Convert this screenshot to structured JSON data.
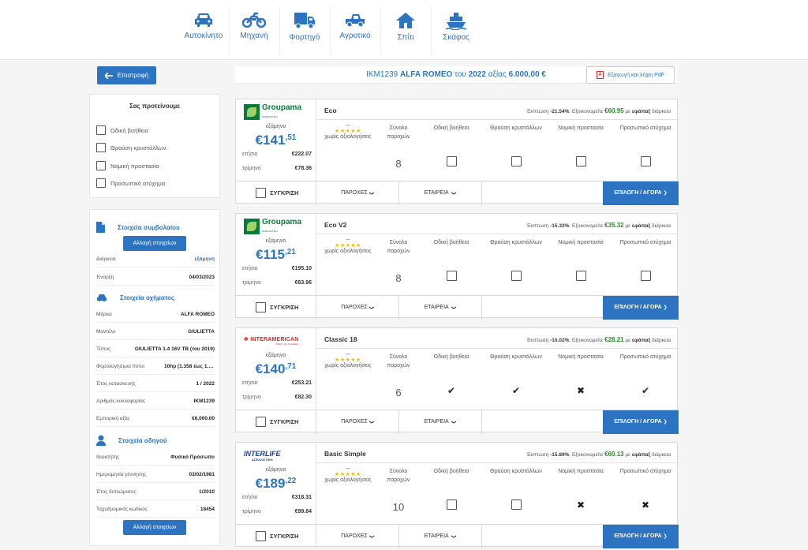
{
  "nav": {
    "items": [
      {
        "label": "Αυτοκίνητο",
        "icon": "car-icon"
      },
      {
        "label": "Μηχανή",
        "icon": "motorcycle-icon"
      },
      {
        "label": "Φορτηγό",
        "icon": "truck-icon"
      },
      {
        "label": "Αγροτικό",
        "icon": "pickup-icon"
      },
      {
        "label": "Σπίτι",
        "icon": "house-icon"
      },
      {
        "label": "Σκάφος",
        "icon": "boat-icon"
      }
    ]
  },
  "header": {
    "back_label": "Επιστροφή",
    "vehicle_prefix": "IKM1239",
    "vehicle_brand": "ALFA ROMEO",
    "vehicle_mid1": "του",
    "vehicle_year": "2022",
    "vehicle_mid2": "αξίας",
    "vehicle_value": "6.000,00 €",
    "pdf_label": "Εξαγωγή και λήψη PdF"
  },
  "suggest": {
    "title": "Σας προτείνουμε",
    "items": [
      "Οδική βοήθεια",
      "Θραύση κρυστάλλων",
      "Νομική προστασία",
      "Προσωπικό ατύχημα"
    ]
  },
  "details": {
    "contract_title": "Στοιχεία συμβολαίου",
    "change_label": "Αλλαγή στοιχείων",
    "contract_rows": [
      {
        "k": "Διάρκεια",
        "v": "εξάμηνη"
      },
      {
        "k": "Έναρξη",
        "v": "04/03/2023"
      }
    ],
    "vehicle_title": "Στοιχεία οχήματος",
    "vehicle_rows": [
      {
        "k": "Μάρκα",
        "v": "ALFA ROMEO"
      },
      {
        "k": "Μοντέλο",
        "v": "GIULIETTA"
      },
      {
        "k": "Τύπος",
        "v": "GIULIETTA 1.4 16V TB (του 2019)"
      },
      {
        "k": "Φορολογήσιμοι ίπποι",
        "v": "10hp (1.358 έως 1.548)"
      },
      {
        "k": "Έτος κατασκευής",
        "v": "1 / 2022"
      },
      {
        "k": "Αριθμός κυκλοφορίας",
        "v": "IKM1239"
      },
      {
        "k": "Εμπορική αξία",
        "v": "€6,000.00"
      }
    ],
    "driver_title": "Στοιχεία οδηγού",
    "driver_rows": [
      {
        "k": "Ιδιοκτήτης",
        "v": "Φυσικό Πρόσωπο"
      },
      {
        "k": "Ημερομηνία γέννησης",
        "v": "03/02/1981"
      },
      {
        "k": "Έτος διπλώματος",
        "v": "1/2010"
      },
      {
        "k": "Ταχυδρομικός κωδικός",
        "v": "18454"
      }
    ],
    "change_label2": "Αλλαγή στοιχείων"
  },
  "labels": {
    "period": "εξάμηνο",
    "annual": "ετήσιο",
    "quarterly": "τρίμηνο",
    "no_eval": "χωρίς αξιολογήσεις",
    "stars": "★★★★★",
    "dash": "–",
    "col_total": "Σύνολο παροχών",
    "col_road": "Οδική βοήθεια",
    "col_glass": "Θραύση κρυστάλλων",
    "col_legal": "Νομική προστασία",
    "col_personal": "Προσωπικό ατύχημα",
    "compare": "ΣΥΓΚΡΙΣΗ",
    "benefits": "ΠΑΡΟΧΕΣ",
    "company": "ΕΤΑΙΡΕΙΑ",
    "buy": "ΕΠΙΛΟΓΗ / ΑΓΟΡΑ",
    "discount_lbl": "Έκπτωση",
    "save_lbl": "Εξοικονομείτε",
    "with_lbl": "με",
    "pay_lbl": "εφάπαξ",
    "duration_lbl": "διάρκεια"
  },
  "offers": [
    {
      "company": "groupama",
      "logo": "Groupama",
      "logo_sub": "ΑΣΦΑΛΙΣΤΙΚΗ",
      "plan": "Eco",
      "price_int": "€141",
      "price_dec": ",51",
      "annual": "€222.07",
      "quarterly": "€78.36",
      "discount": "-21.54%",
      "save": "€60.95",
      "total": "8",
      "road": "box",
      "glass": "box",
      "legal": "box",
      "personal": "box"
    },
    {
      "company": "groupama",
      "logo": "Groupama",
      "logo_sub": "ΑΣΦΑΛΙΣΤΙΚΗ",
      "plan": "Eco V2",
      "price_int": "€115",
      "price_dec": ",21",
      "annual": "€195.10",
      "quarterly": "€63.96",
      "discount": "-15.33%",
      "save": "€35.32",
      "total": "8",
      "road": "box",
      "glass": "box",
      "legal": "box",
      "personal": "box"
    },
    {
      "company": "interamerican",
      "logo": "INTERAMERICAN",
      "logo_sub": "PART OF ACHMEA",
      "plan": "Classic 18",
      "price_int": "€140",
      "price_dec": ",71",
      "annual": "€253.21",
      "quarterly": "€82.30",
      "discount": "-10.02%",
      "save": "€28.21",
      "total": "6",
      "road": "check",
      "glass": "check",
      "legal": "cross",
      "personal": "check"
    },
    {
      "company": "interlife",
      "logo": "INTERLIFE",
      "logo_sub": "ΑΣΦΑΛΙΣΤΙΚΗ",
      "plan": "Basic Simple",
      "price_int": "€189",
      "price_dec": ",22",
      "annual": "€318.31",
      "quarterly": "€99.84",
      "discount": "-15.89%",
      "save": "€60.13",
      "total": "10",
      "road": "box",
      "glass": "box",
      "legal": "cross",
      "personal": "cross"
    }
  ],
  "colors": {
    "primary": "#2c74c2",
    "save_green": "#2a8a2a",
    "star": "#f5b800"
  }
}
